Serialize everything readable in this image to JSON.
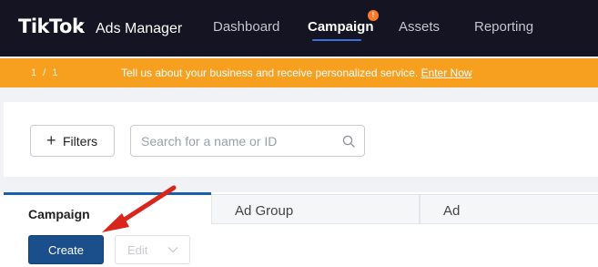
{
  "brand": {
    "logo": "TikTok",
    "product": "Ads Manager"
  },
  "nav": {
    "items": [
      {
        "label": "Dashboard"
      },
      {
        "label": "Campaign",
        "active": true
      },
      {
        "label": "Assets"
      },
      {
        "label": "Reporting"
      }
    ],
    "badge_icon": "alert-badge-icon"
  },
  "banner": {
    "pager": "1 / 1",
    "message": "Tell us about your business and receive personalized service.",
    "link": "Enter Now"
  },
  "filters": {
    "button_label": "Filters",
    "button_icon": "plus-icon",
    "search": {
      "placeholder": "Search for a name or ID",
      "value": "",
      "icon": "search-icon"
    }
  },
  "tabs": [
    {
      "label": "Campaign",
      "active": true
    },
    {
      "label": "Ad Group"
    },
    {
      "label": "Ad"
    }
  ],
  "toolbar": {
    "create_label": "Create",
    "edit_label": "Edit",
    "edit_icon": "chevron-down-icon"
  },
  "annotation": {
    "arrow_color": "#d9261c",
    "points_to": "create-button"
  },
  "colors": {
    "nav_bg": "#141422",
    "banner_bg": "#f7a020",
    "primary": "#1b4f8c",
    "active_tab_border": "#1b5fa8"
  }
}
